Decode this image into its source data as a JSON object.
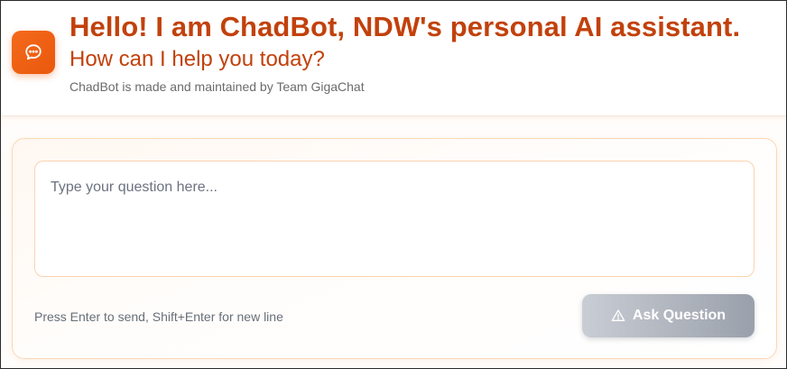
{
  "header": {
    "title": "Hello! I am ChadBot, NDW's personal AI assistant.",
    "subtitle": "How can I help you today?",
    "credit": "ChadBot is made and maintained by Team GigaChat",
    "logo_icon": "chat-bubble-icon"
  },
  "composer": {
    "placeholder": "Type your question here...",
    "value": "",
    "hint": "Press Enter to send, Shift+Enter for new line",
    "ask_button_label": "Ask Question",
    "ask_button_icon": "warning-triangle-icon",
    "ask_button_state": "disabled"
  },
  "colors": {
    "brand_orange": "#ea580c",
    "title_color": "#c2410c",
    "button_gray": "#9aa0ab"
  }
}
